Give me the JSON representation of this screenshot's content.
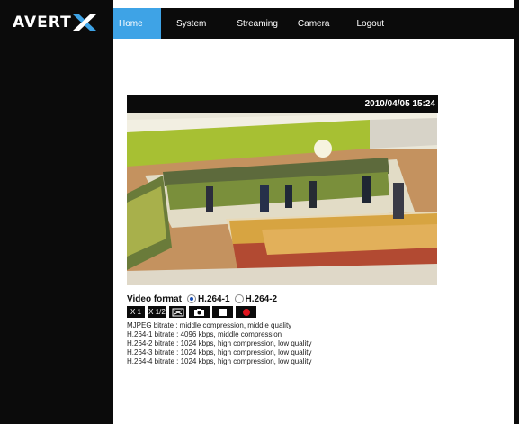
{
  "brand": {
    "logo_text": "AVERT",
    "logo_mark": "X"
  },
  "nav": {
    "items": [
      {
        "label": "Home",
        "active": true
      },
      {
        "label": "System"
      },
      {
        "label": "Streaming"
      },
      {
        "label": "Camera"
      },
      {
        "label": "Logout"
      }
    ]
  },
  "video": {
    "timestamp": "2010/04/05 15:24",
    "video_format_label": "Video format",
    "formats": [
      {
        "label": "H.264-1",
        "selected": true
      },
      {
        "label": "H.264-2",
        "selected": false
      }
    ],
    "buttons": [
      {
        "label": "X 1",
        "icon": "zoom-1x"
      },
      {
        "label": "X 1/2",
        "icon": "zoom-half"
      },
      {
        "label": "",
        "icon": "fit-screen-icon"
      },
      {
        "label": "",
        "icon": "camera-icon"
      },
      {
        "label": "",
        "icon": "stop-icon"
      },
      {
        "label": "",
        "icon": "record-icon"
      }
    ]
  },
  "stream_info": [
    "MJPEG bitrate : middle compression, middle quality",
    "H.264-1 bitrate : 4096 kbps, middle compression",
    "H.264-2 bitrate : 1024 kbps, high compression, low quality",
    "H.264-3 bitrate : 1024 kbps, high compression, low quality",
    "H.264-4 bitrate : 1024 kbps, high compression, low quality"
  ],
  "colors": {
    "nav_active": "#3ea3e6",
    "frame_black": "#0b0b0b",
    "record_red": "#e0141e"
  }
}
